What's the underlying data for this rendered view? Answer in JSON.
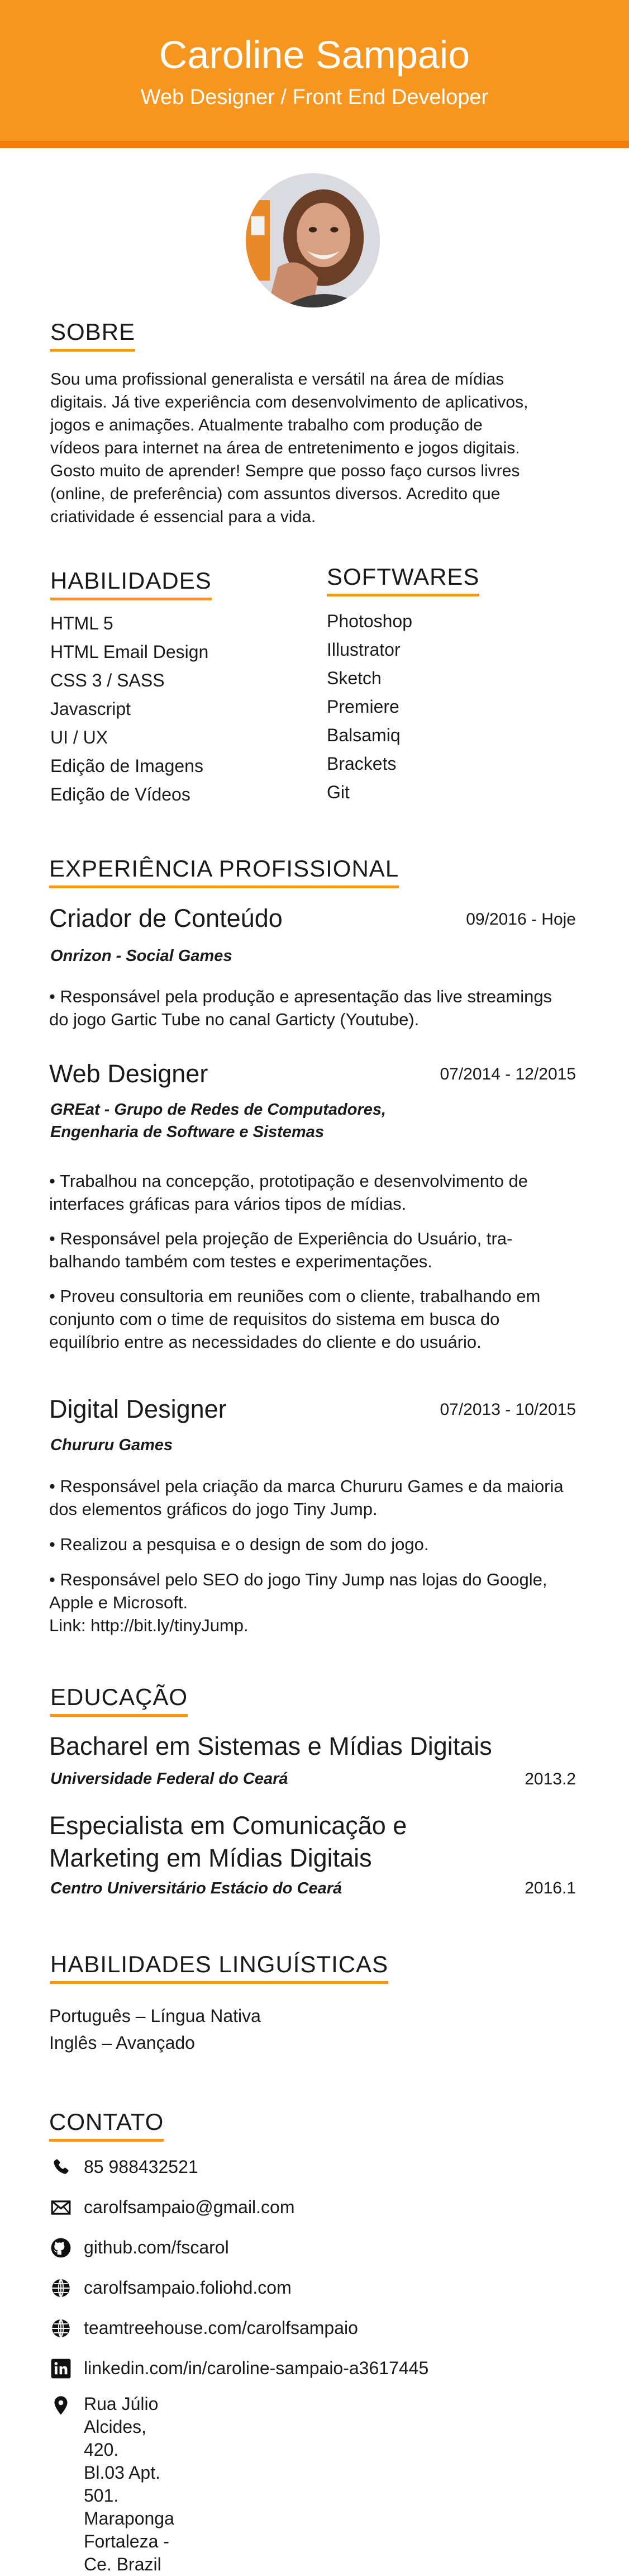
{
  "header": {
    "name": "Caroline Sampaio",
    "role": "Web Designer / Front End Developer"
  },
  "about": {
    "title": "SOBRE",
    "lines": [
      "Sou uma profissional generalista e versátil na área de mídias",
      "digitais. Já tive experiência com desenvolvimento de aplicativos,",
      "jogos e animações. Atualmente trabalho com produção de",
      "vídeos para internet na área de entretenimento e jogos digitais.",
      "Gosto muito de aprender! Sempre que posso faço cursos livres",
      "(online, de preferência) com assuntos diversos. Acredito que",
      "criatividade é essencial para a vida."
    ]
  },
  "skills": {
    "title": "HABILIDADES",
    "items": [
      "HTML 5",
      "HTML Email Design",
      "CSS 3 / SASS",
      "Javascript",
      "UI / UX",
      "Edição de Imagens",
      "Edição de Vídeos"
    ]
  },
  "software": {
    "title": "SOFTWARES",
    "items": [
      "Photoshop",
      "Illustrator",
      "Sketch",
      "Premiere",
      "Balsamiq",
      "Brackets",
      "Git"
    ]
  },
  "experience": {
    "title": "EXPERIÊNCIA PROFISSIONAL",
    "jobs": [
      {
        "title": "Criador de Conteúdo",
        "date": "09/2016 - Hoje",
        "company_lines": [
          "Onrizon - Social Games"
        ],
        "bullets": [
          [
            "• Responsável pela produção e apresentação das live streamings",
            "do jogo Gartic Tube no canal Garticty (Youtube)."
          ]
        ]
      },
      {
        "title": "Web Designer",
        "date": "07/2014 - 12/2015",
        "company_lines": [
          "GREat - Grupo de Redes de Computadores,",
          "Engenharia de Software e Sistemas"
        ],
        "bullets": [
          [
            "• Trabalhou na concepção, prototipação e desenvolvimento de",
            "interfaces gráficas para vários tipos de mídias."
          ],
          [
            "• Responsável pela projeção de Experiência do Usuário, tra-",
            "balhando também com testes e experimentações."
          ],
          [
            "• Proveu consultoria em reuniões com o cliente, trabalhando  em",
            "conjunto com o time de requisitos do sistema em busca do",
            "equilíbrio entre as necessidades do cliente e do usuário."
          ]
        ]
      },
      {
        "title": "Digital Designer",
        "date": "07/2013 - 10/2015",
        "company_lines": [
          "Chururu Games"
        ],
        "bullets": [
          [
            "• Responsável pela criação da marca Chururu Games e da maioria",
            "dos elementos gráficos do jogo Tiny Jump."
          ],
          [
            "• Realizou a pesquisa e o design de som do jogo."
          ],
          [
            "• Responsável pelo SEO do jogo Tiny Jump nas lojas do Google,",
            "Apple e Microsoft.",
            "Link: http://bit.ly/tinyJump."
          ]
        ]
      }
    ]
  },
  "education": {
    "title": "EDUCAÇÃO",
    "items": [
      {
        "title_lines": [
          "Bacharel em Sistemas e Mídias Digitais"
        ],
        "school": "Universidade Federal do Ceará",
        "date": "2013.2"
      },
      {
        "title_lines": [
          "Especialista em Comunicação e",
          "Marketing em Mídias Digitais"
        ],
        "school": "Centro Universitário Estácio do Ceará",
        "date": "2016.1"
      }
    ]
  },
  "languages": {
    "title": "HABILIDADES LINGUÍSTICAS",
    "items": [
      "Português – Língua Nativa",
      "Inglês – Avançado"
    ]
  },
  "contact": {
    "title": "CONTATO",
    "items": [
      {
        "icon": "phone-icon",
        "text": "85 988432521"
      },
      {
        "icon": "mail-icon",
        "text": "carolfsampaio@gmail.com"
      },
      {
        "icon": "github-icon",
        "text": "github.com/fscarol"
      },
      {
        "icon": "globe-icon",
        "text": "carolfsampaio.foliohd.com"
      },
      {
        "icon": "globe-icon",
        "text": "teamtreehouse.com/carolfsampaio"
      },
      {
        "icon": "linkedin-icon",
        "text": "linkedin.com/in/caroline-sampaio-a3617445"
      }
    ],
    "address_icon": "location-pin-icon",
    "address_lines": [
      "Rua Júlio Alcides, 420.",
      "Bl.03 Apt. 501. Maraponga",
      "Fortaleza - Ce. Brazil"
    ]
  },
  "colors": {
    "accent": "#f7961e",
    "accent_dark": "#f07d0d",
    "text": "#1a1a1a"
  }
}
